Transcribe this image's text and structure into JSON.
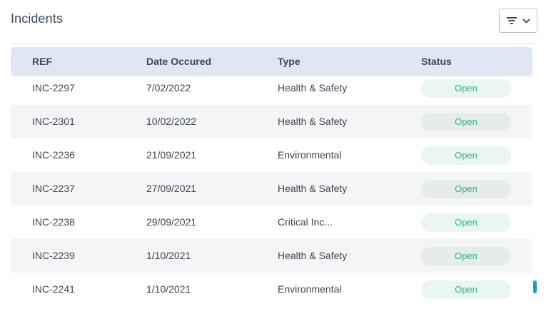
{
  "header": {
    "title": "Incidents"
  },
  "filter_button": {
    "icon": "filter-lines-icon",
    "dropdown_icon": "chevron-down-icon"
  },
  "table": {
    "columns": [
      "REF",
      "Date Occured",
      "Type",
      "Status"
    ],
    "rows": [
      {
        "ref": "INC-2297",
        "date": "7/02/2022",
        "type": "Health & Safety",
        "status": "Open"
      },
      {
        "ref": "INC-2301",
        "date": "10/02/2022",
        "type": "Health & Safety",
        "status": "Open"
      },
      {
        "ref": "INC-2236",
        "date": "21/09/2021",
        "type": "Environmental",
        "status": "Open"
      },
      {
        "ref": "INC-2237",
        "date": "27/09/2021",
        "type": "Health & Safety",
        "status": "Open"
      },
      {
        "ref": "INC-2238",
        "date": "29/09/2021",
        "type": "Critical Inc...",
        "status": "Open"
      },
      {
        "ref": "INC-2239",
        "date": "1/10/2021",
        "type": "Health & Safety",
        "status": "Open"
      },
      {
        "ref": "INC-2241",
        "date": "1/10/2021",
        "type": "Environmental",
        "status": "Open"
      }
    ]
  },
  "colors": {
    "status_open_text": "#34b37a",
    "status_open_bg": "#eaf6f1",
    "header_bg": "#e0e7f4",
    "scrollbar": "#1a9bd8"
  }
}
